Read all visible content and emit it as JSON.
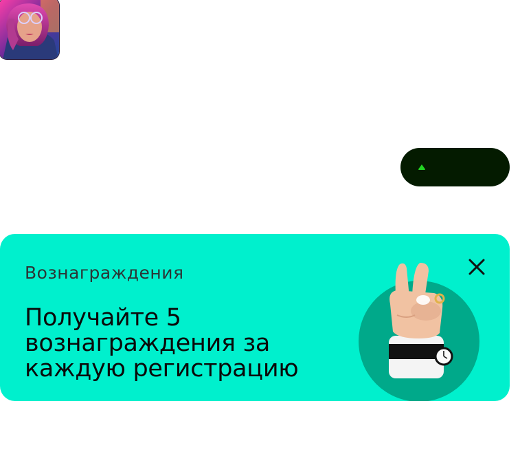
{
  "avatar": {
    "alt": "user avatar",
    "icon": "user-photo"
  },
  "status": {
    "icon": "up-arrow-icon",
    "value": "",
    "accent": "#22d422",
    "bg": "#041b00"
  },
  "reward": {
    "category": "Вознаграждения",
    "headline": "Получайте 5 вознаграждения за каждую регистрацию",
    "close_icon": "close-icon",
    "illustration_icon": "victory-hand-icon",
    "bg": "#00f0cd",
    "circle": "#00a98a"
  }
}
